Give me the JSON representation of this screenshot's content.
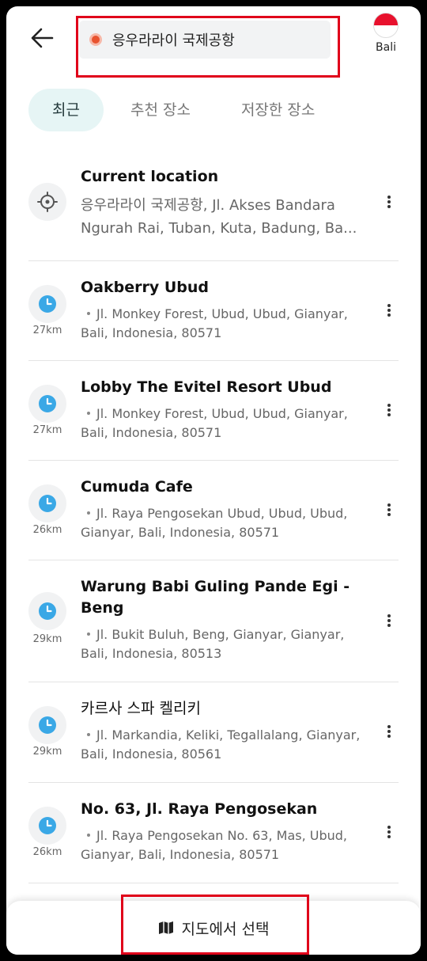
{
  "header": {
    "search_text": "응우라라이 국제공항",
    "region_label": "Bali"
  },
  "tabs": [
    {
      "label": "최근",
      "active": true
    },
    {
      "label": "추천 장소",
      "active": false
    },
    {
      "label": "저장한 장소",
      "active": false
    }
  ],
  "current": {
    "title": "Current location",
    "address": "응우라라이 국제공항, Jl. Akses Bandara Ngurah Rai, Tuban, Kuta, Badung, Ba..."
  },
  "recent": [
    {
      "title": "Oakberry Ubud",
      "distance": "27km",
      "address": "Jl. Monkey Forest, Ubud, Ubud, Gianyar, Bali, Indonesia, 80571"
    },
    {
      "title": "Lobby The Evitel Resort Ubud",
      "distance": "27km",
      "address": "Jl. Monkey Forest, Ubud, Ubud, Gianyar, Bali, Indonesia, 80571"
    },
    {
      "title": "Cumuda Cafe",
      "distance": "26km",
      "address": "Jl. Raya Pengosekan Ubud, Ubud, Ubud, Gianyar, Bali, Indonesia, 80571"
    },
    {
      "title": "Warung Babi Guling Pande Egi - Beng",
      "distance": "29km",
      "address": "Jl. Bukit Buluh, Beng, Gianyar, Gianyar, Bali, Indonesia, 80513"
    },
    {
      "title": "카르사 스파 켈리키",
      "distance": "29km",
      "address": "Jl. Markandia, Keliki, Tegallalang, Gianyar, Bali, Indonesia, 80561"
    },
    {
      "title": "No. 63, Jl. Raya Pengosekan",
      "distance": "26km",
      "address": "Jl. Raya Pengosekan No. 63, Mas, Ubud, Gianyar, Bali, Indonesia, 80571"
    }
  ],
  "footer": {
    "map_button_label": "지도에서 선택",
    "map_icon": "map-icon"
  },
  "colors": {
    "accent_tab_bg": "#e6f5f5",
    "clock_blue": "#3aa8e6",
    "origin_red": "#e8532f",
    "highlight_red": "#e0001a"
  }
}
